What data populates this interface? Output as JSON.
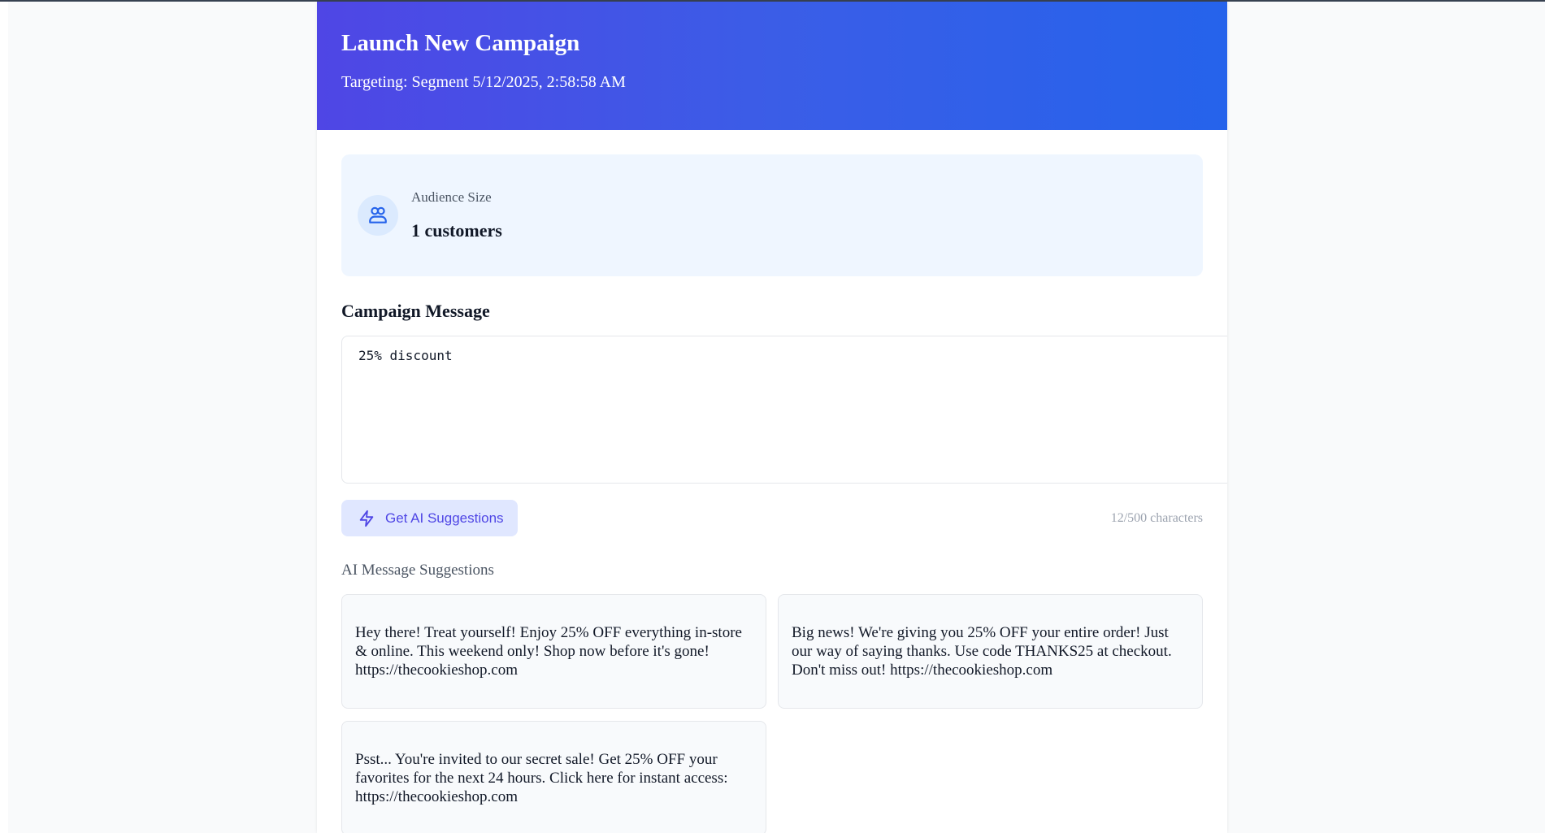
{
  "header": {
    "title": "Launch New Campaign",
    "subtitle": "Targeting: Segment 5/12/2025, 2:58:58 AM"
  },
  "audience": {
    "label": "Audience Size",
    "value": "1 customers",
    "icon": "users-icon"
  },
  "message": {
    "section_title": "Campaign Message",
    "value": "25% discount",
    "char_count": "12/500 characters"
  },
  "ai": {
    "button_label": "Get AI Suggestions",
    "button_icon": "lightning-icon",
    "suggestions_title": "AI Message Suggestions",
    "suggestions": [
      "Hey there! Treat yourself! Enjoy 25% OFF everything in-store & online. This weekend only! Shop now before it's gone! https://thecookieshop.com",
      "Big news! We're giving you 25% OFF your entire order! Just our way of saying thanks. Use code THANKS25 at checkout. Don't miss out! https://thecookieshop.com",
      "Psst... You're invited to our secret sale! Get 25% OFF your favorites for the next 24 hours. Click here for instant access: https://thecookieshop.com"
    ]
  },
  "colors": {
    "header_gradient_start": "#4f46e5",
    "header_gradient_end": "#2563eb",
    "audience_bg": "#eff6ff",
    "accent": "#4f46e5"
  }
}
